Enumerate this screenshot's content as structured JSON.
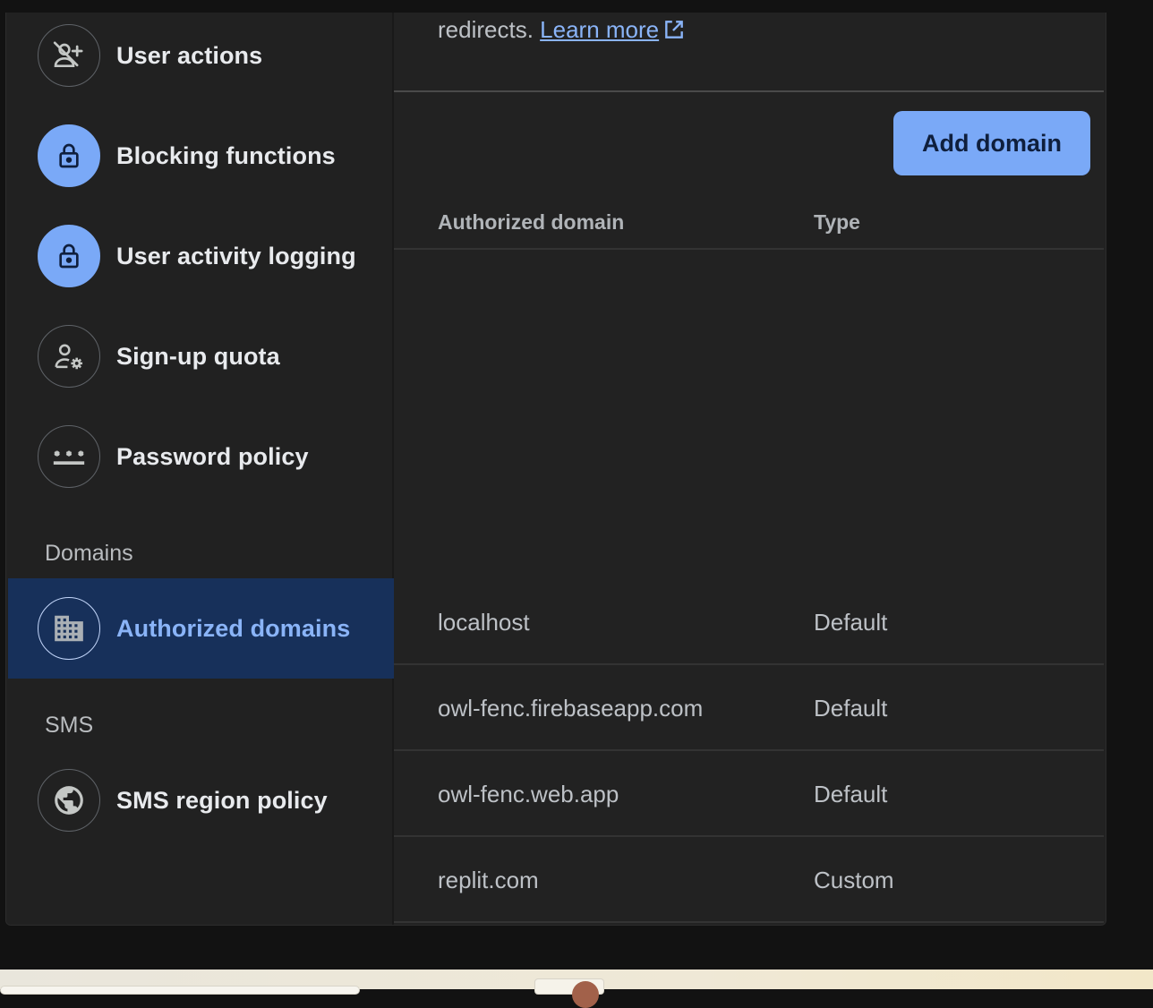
{
  "sidebar": {
    "items_top": [
      {
        "label": "User actions",
        "icon": "person-off-icon"
      },
      {
        "label": "Blocking functions",
        "icon": "lock-icon"
      },
      {
        "label": "User activity logging",
        "icon": "lock-icon"
      },
      {
        "label": "Sign-up quota",
        "icon": "person-gear-icon"
      },
      {
        "label": "Password policy",
        "icon": "password-icon"
      }
    ],
    "domains_header": "Domains",
    "authorized_domains_label": "Authorized domains",
    "sms_header": "SMS",
    "sms_region_policy_label": "SMS region policy"
  },
  "main": {
    "description_text": "redirects.",
    "learn_more_label": "Learn more",
    "add_domain_label": "Add domain",
    "table": {
      "headers": {
        "domain": "Authorized domain",
        "type": "Type"
      },
      "rows": [
        {
          "domain": "localhost",
          "type": "Default"
        },
        {
          "domain": "owl-fenc.firebaseapp.com",
          "type": "Default"
        },
        {
          "domain": "owl-fenc.web.app",
          "type": "Default"
        },
        {
          "domain": "replit.com",
          "type": "Custom"
        }
      ]
    }
  },
  "colors": {
    "accent": "#8ab4f8",
    "button_bg": "#7aa9f7",
    "active_bg": "#17305a",
    "panel_bg": "#222222"
  }
}
